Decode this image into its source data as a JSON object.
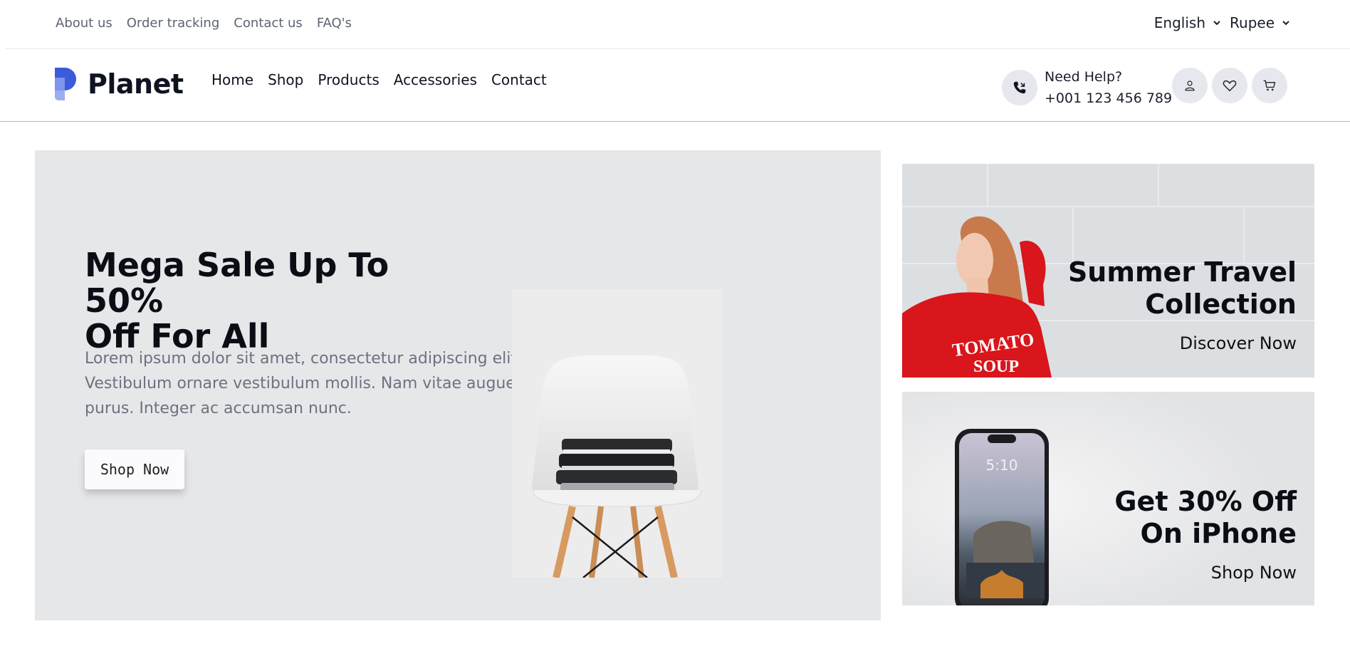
{
  "topbar": {
    "links": [
      "About us",
      "Order tracking",
      "Contact us",
      "FAQ's"
    ],
    "language": "English",
    "currency": "Rupee"
  },
  "header": {
    "brand": "Planet",
    "nav": [
      "Home",
      "Shop",
      "Products",
      "Accessories",
      "Contact"
    ],
    "help_label": "Need Help?",
    "help_phone": "+001 123 456 789"
  },
  "hero": {
    "title_line1": "Mega Sale Up To 50%",
    "title_line2": "Off For All",
    "description": "Lorem ipsum dolor sit amet, consectetur adipiscing elit. Vestibulum ornare vestibulum mollis. Nam vitae augue purus. Integer ac accumsan nunc.",
    "button": "Shop Now"
  },
  "banners": [
    {
      "title_line1": "Summer Travel",
      "title_line2": "Collection",
      "link": "Discover Now",
      "sweater_text_1": "TOMATO",
      "sweater_text_2": "SOUP"
    },
    {
      "title_line1": "Get 30% Off",
      "title_line2": "On iPhone",
      "link": "Shop Now",
      "phone_time": "5:10"
    }
  ],
  "colors": {
    "accent_logo": "#3b5bdb",
    "header_border": "#e6a1a8",
    "hero_bg": "#e6e7e9",
    "icon_circle": "#e6e8ee"
  },
  "icons": [
    "chevron-down-icon",
    "phone-icon",
    "user-icon",
    "heart-icon",
    "cart-icon"
  ]
}
